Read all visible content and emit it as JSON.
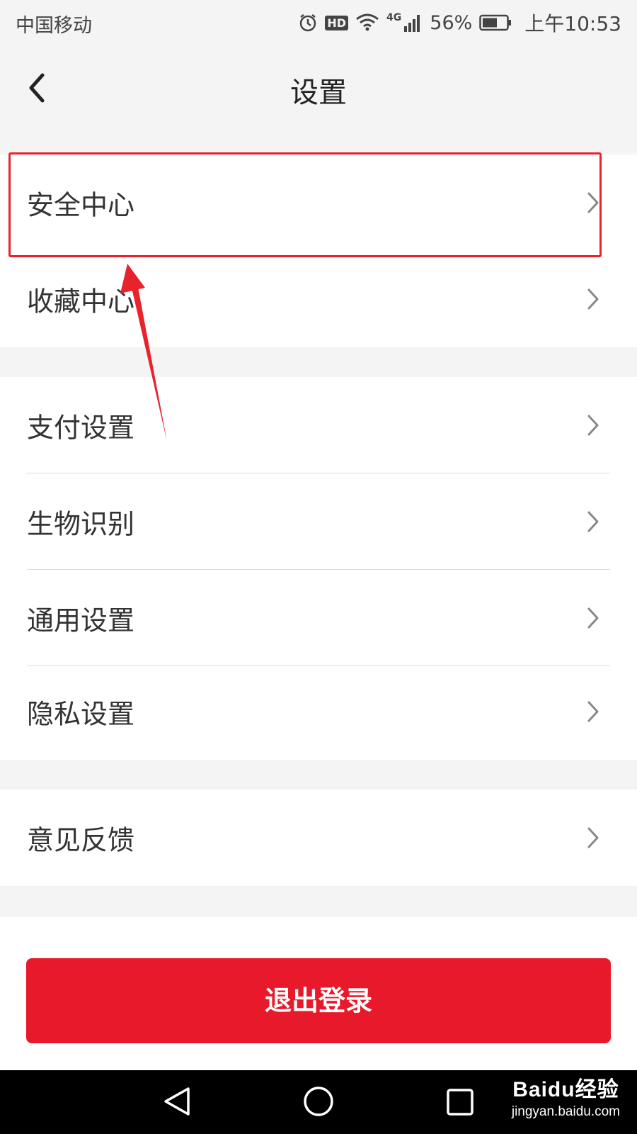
{
  "status_bar": {
    "carrier": "中国移动",
    "network": "4G",
    "hd_badge": "HD",
    "battery": "56%",
    "time": "上午10:53",
    "icons": [
      "alarm-icon",
      "hd-icon",
      "wifi-icon",
      "signal-icon",
      "battery-icon"
    ]
  },
  "header": {
    "title": "设置",
    "back_icon": "chevron-left-icon"
  },
  "groups": [
    {
      "items": [
        {
          "label": "安全中心"
        },
        {
          "label": "收藏中心"
        }
      ]
    },
    {
      "items": [
        {
          "label": "支付设置"
        },
        {
          "label": "生物识别"
        },
        {
          "label": "通用设置"
        },
        {
          "label": "隐私设置"
        }
      ]
    },
    {
      "items": [
        {
          "label": "意见反馈"
        }
      ]
    }
  ],
  "logout_button": {
    "label": "退出登录"
  },
  "system_nav": {
    "icons": [
      "back-triangle-icon",
      "home-circle-icon",
      "recents-square-icon"
    ]
  },
  "watermark": {
    "brand": "Baidu经验",
    "url": "jingyan.baidu.com"
  },
  "colors": {
    "accent_red": "#e8192a",
    "annotation_red": "#e8232c",
    "background": "#f4f4f4"
  }
}
